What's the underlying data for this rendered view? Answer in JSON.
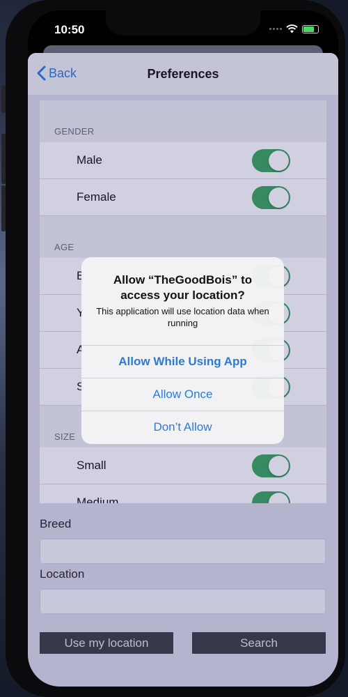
{
  "status_bar": {
    "time": "10:50"
  },
  "navbar": {
    "back_label": "Back",
    "title": "Preferences"
  },
  "sections": [
    {
      "header": "GENDER",
      "rows": [
        {
          "label": "Male",
          "on": true
        },
        {
          "label": "Female",
          "on": true
        }
      ]
    },
    {
      "header": "AGE",
      "rows": [
        {
          "label": "B",
          "on": true
        },
        {
          "label": "Y",
          "on": true
        },
        {
          "label": "A",
          "on": true
        },
        {
          "label": "S",
          "on": true
        }
      ]
    },
    {
      "header": "SIZE",
      "rows": [
        {
          "label": "Small",
          "on": true
        },
        {
          "label": "Medium",
          "on": true
        }
      ]
    }
  ],
  "form": {
    "breed_label": "Breed",
    "breed_value": "",
    "location_label": "Location",
    "location_value": "",
    "use_location_button": "Use my location",
    "search_button": "Search"
  },
  "alert": {
    "title": "Allow “TheGoodBois” to access your location?",
    "message": "This application will use location data when running",
    "actions": [
      "Allow While Using App",
      "Allow Once",
      "Don’t Allow"
    ]
  },
  "colors": {
    "toggle_on": "#3aa45a",
    "accent": "#2c7ad6"
  }
}
